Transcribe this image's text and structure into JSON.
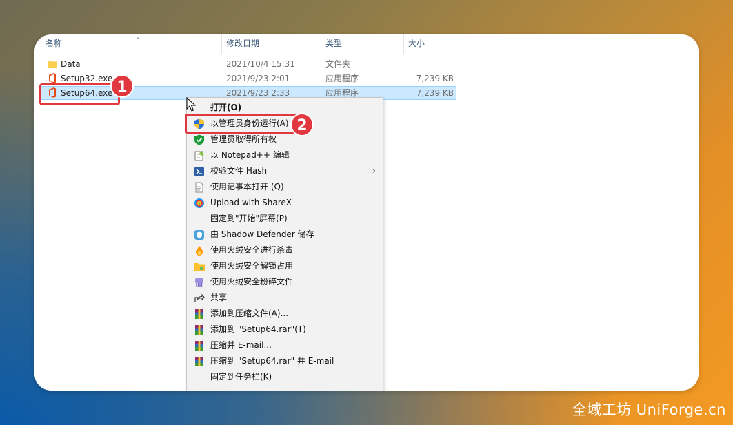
{
  "columns": {
    "name": "名称",
    "date": "修改日期",
    "type": "类型",
    "size": "大小"
  },
  "files": [
    {
      "name": "Data",
      "date": "2021/10/4 15:31",
      "type": "文件夹",
      "size": "",
      "icon": "folder-icon"
    },
    {
      "name": "Setup32.exe",
      "date": "2021/9/23 2:01",
      "type": "应用程序",
      "size": "7,239 KB",
      "icon": "office-icon"
    },
    {
      "name": "Setup64.exe",
      "date": "2021/9/23 2:33",
      "type": "应用程序",
      "size": "7,239 KB",
      "icon": "office-icon",
      "selected": true
    }
  ],
  "badges": {
    "one": "1",
    "two": "2"
  },
  "context_menu": {
    "items": [
      {
        "label": "打开(O)",
        "icon": "none",
        "bold": true
      },
      {
        "label": "以管理员身份运行(A)",
        "icon": "uac-shield-icon"
      },
      {
        "label": "管理员取得所有权",
        "icon": "green-shield-icon"
      },
      {
        "label": "以 Notepad++ 编辑",
        "icon": "notepad-plus-plus-icon"
      },
      {
        "label": "校验文件 Hash",
        "icon": "powershell-icon",
        "submenu": true
      },
      {
        "label": "使用记事本打开 (Q)",
        "icon": "document-icon"
      },
      {
        "label": "Upload with ShareX",
        "icon": "sharex-icon"
      },
      {
        "label": "固定到\"开始\"屏幕(P)",
        "icon": "none"
      },
      {
        "label": "由 Shadow Defender 储存",
        "icon": "shadow-defender-icon"
      },
      {
        "label": "使用火绒安全进行杀毒",
        "icon": "huorong-icon"
      },
      {
        "label": "使用火绒安全解锁占用",
        "icon": "folder-lock-icon"
      },
      {
        "label": "使用火绒安全粉碎文件",
        "icon": "shredder-icon"
      },
      {
        "label": "共享",
        "icon": "share-icon"
      },
      {
        "label": "添加到压缩文件(A)...",
        "icon": "winrar-icon"
      },
      {
        "label": "添加到 \"Setup64.rar\"(T)",
        "icon": "winrar-icon"
      },
      {
        "label": "压缩并 E-mail...",
        "icon": "winrar-icon"
      },
      {
        "label": "压缩到 \"Setup64.rar\" 并 E-mail",
        "icon": "winrar-icon"
      },
      {
        "label": "固定到任务栏(K)",
        "icon": "none"
      }
    ]
  },
  "watermark": "全域工坊 UniForge.cn",
  "colors": {
    "highlight": "#e0383e",
    "selection": "#cce8ff"
  }
}
